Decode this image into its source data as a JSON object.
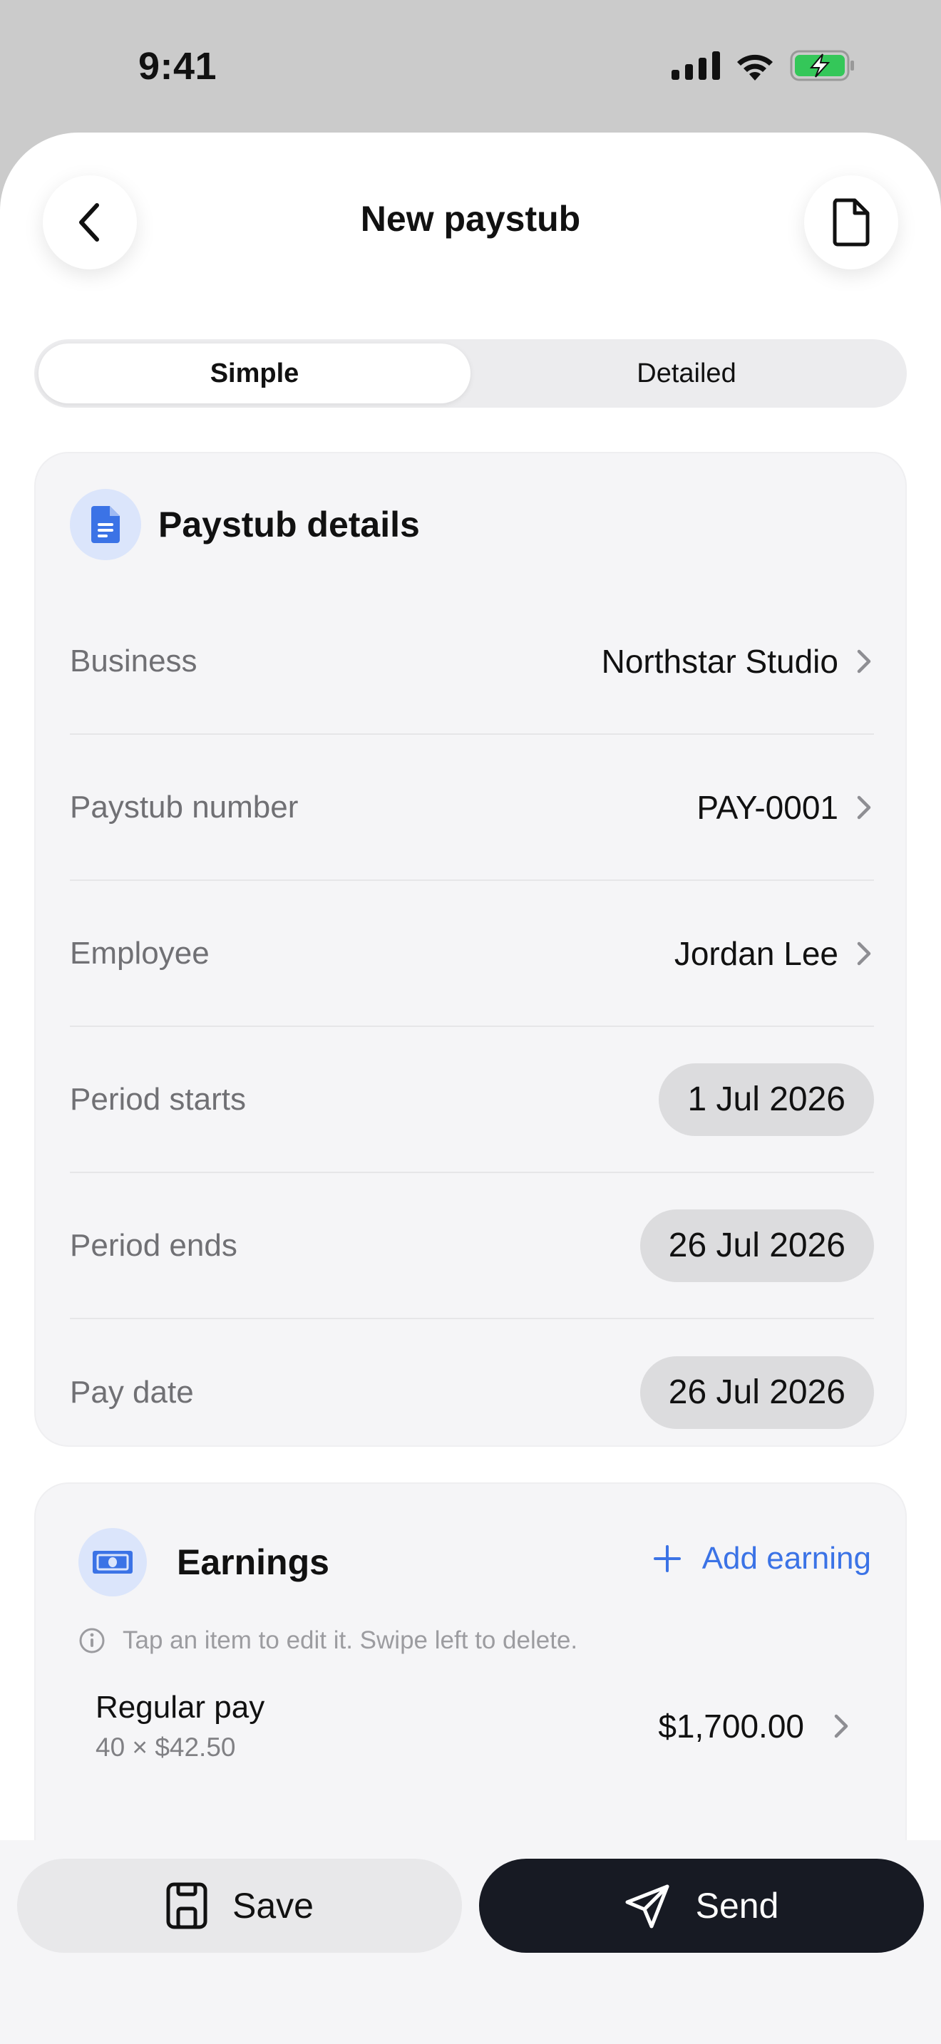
{
  "status": {
    "time": "9:41"
  },
  "header": {
    "title": "New paystub"
  },
  "tabs": [
    {
      "label": "Simple"
    },
    {
      "label": "Detailed"
    }
  ],
  "details": {
    "title": "Paystub details",
    "rows": [
      {
        "label": "Business",
        "value": "Northstar Studio"
      },
      {
        "label": "Paystub number",
        "value": "PAY-0001"
      },
      {
        "label": "Employee",
        "value": "Jordan Lee"
      },
      {
        "label": "Period starts",
        "value": "1 Jul 2026"
      },
      {
        "label": "Period ends",
        "value": "26 Jul 2026"
      },
      {
        "label": "Pay date",
        "value": "26 Jul 2026"
      }
    ]
  },
  "earnings": {
    "title": "Earnings",
    "add_label": "Add earning",
    "hint": "Tap an item to edit it. Swipe left to delete.",
    "items": [
      {
        "name": "Regular pay",
        "detail": "40 × $42.50",
        "amount": "$1,700.00"
      }
    ]
  },
  "actions": {
    "save_label": "Save",
    "send_label": "Send"
  },
  "colors": {
    "accent": "#3b73e6",
    "primary_button": "#171a23",
    "battery": "#34c759"
  }
}
